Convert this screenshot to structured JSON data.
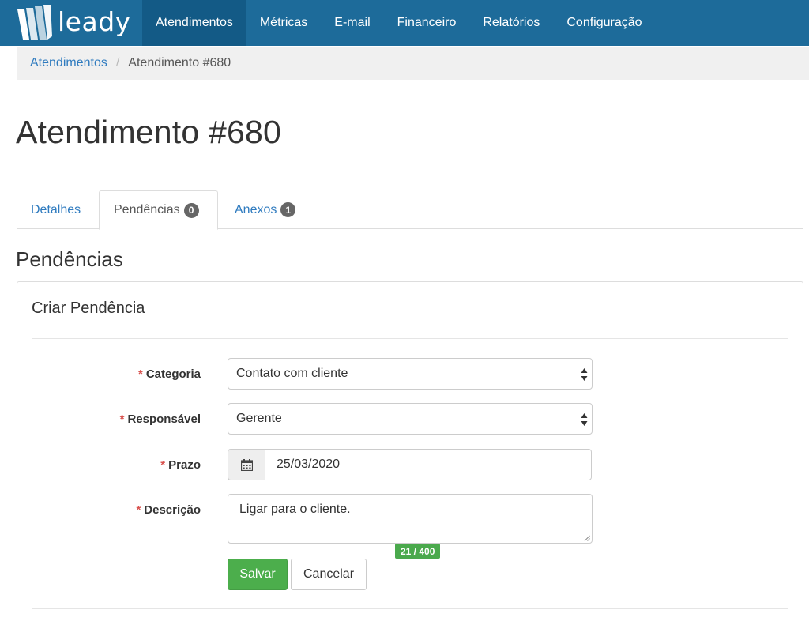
{
  "brand": {
    "name": "leady",
    "logo_icon": "leady-logo-icon"
  },
  "nav": {
    "items": [
      {
        "label": "Atendimentos",
        "active": true
      },
      {
        "label": "Métricas",
        "active": false
      },
      {
        "label": "E-mail",
        "active": false
      },
      {
        "label": "Financeiro",
        "active": false
      },
      {
        "label": "Relatórios",
        "active": false
      },
      {
        "label": "Configuração",
        "active": false
      }
    ]
  },
  "breadcrumb": {
    "parent": "Atendimentos",
    "separator": "/",
    "current": "Atendimento #680"
  },
  "page_title": "Atendimento #680",
  "tabs": [
    {
      "label": "Detalhes",
      "badge": null,
      "active": false
    },
    {
      "label": "Pendências",
      "badge": "0",
      "active": true
    },
    {
      "label": "Anexos",
      "badge": "1",
      "active": false
    }
  ],
  "section_title": "Pendências",
  "panel": {
    "title": "Criar Pendência",
    "required_marker": "*",
    "fields": {
      "categoria": {
        "label": "Categoria",
        "value": "Contato com cliente"
      },
      "responsavel": {
        "label": "Responsável",
        "value": "Gerente"
      },
      "prazo": {
        "label": "Prazo",
        "value": "25/03/2020",
        "icon": "calendar-icon"
      },
      "descricao": {
        "label": "Descrição",
        "value": "Ligar para o cliente."
      }
    },
    "char_counter": "21 / 400",
    "buttons": {
      "save": "Salvar",
      "cancel": "Cancelar"
    }
  },
  "colors": {
    "navbar": "#1d6b9a",
    "navbar_active": "#135a86",
    "link": "#2f7bbf",
    "required": "#d9534f",
    "success": "#4cae4c",
    "badge": "#666666"
  }
}
